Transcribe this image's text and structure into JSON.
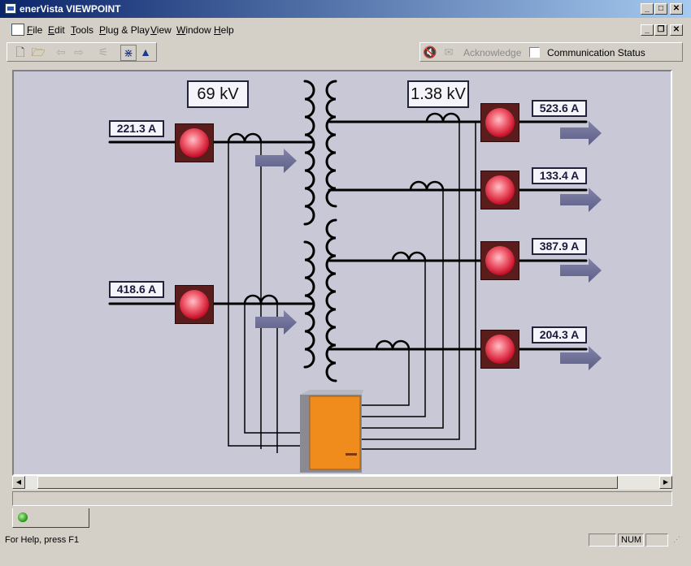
{
  "window": {
    "title": "enerVista VIEWPOINT"
  },
  "menu": [
    {
      "label": "File",
      "key": "F",
      "rest": "ile"
    },
    {
      "label": "Edit",
      "key": "E",
      "rest": "dit"
    },
    {
      "label": "Tools",
      "key": "T",
      "rest": "ools"
    },
    {
      "label": "Plug & Play",
      "key": "P",
      "rest": "lug & Play"
    },
    {
      "label": "View",
      "key": "V",
      "rest": "iew"
    },
    {
      "label": "Window",
      "key": "W",
      "rest": "indow"
    },
    {
      "label": "Help",
      "key": "H",
      "rest": "elp"
    }
  ],
  "toolbar": {
    "icons": [
      "new-file-icon",
      "open-folder-icon",
      "back-arrow-icon",
      "forward-arrow-icon",
      "plug-icon",
      "network-icon",
      "analyzer-icon"
    ],
    "acknowledge_label": "Acknowledge",
    "comm_status_label": "Communication Status",
    "comm_status_checked": false
  },
  "diagram": {
    "primary_voltage": "69 kV",
    "secondary_voltage": "1.38 kV",
    "input_currents": [
      "221.3 A",
      "418.6 A"
    ],
    "output_currents": [
      "523.6 A",
      "133.4 A",
      "387.9 A",
      "204.3 A"
    ],
    "breaker_color": "#e83a4a",
    "arrow_color": "#6f7098",
    "relay_color": "#f08c1c"
  },
  "statusbar": {
    "help_text": "For Help, press F1",
    "num_indicator": "NUM"
  },
  "colors": {
    "titlebar_start": "#0a246a",
    "titlebar_end": "#a6caf0",
    "canvas": "#c9c8d7",
    "status_led": "#30a020"
  }
}
